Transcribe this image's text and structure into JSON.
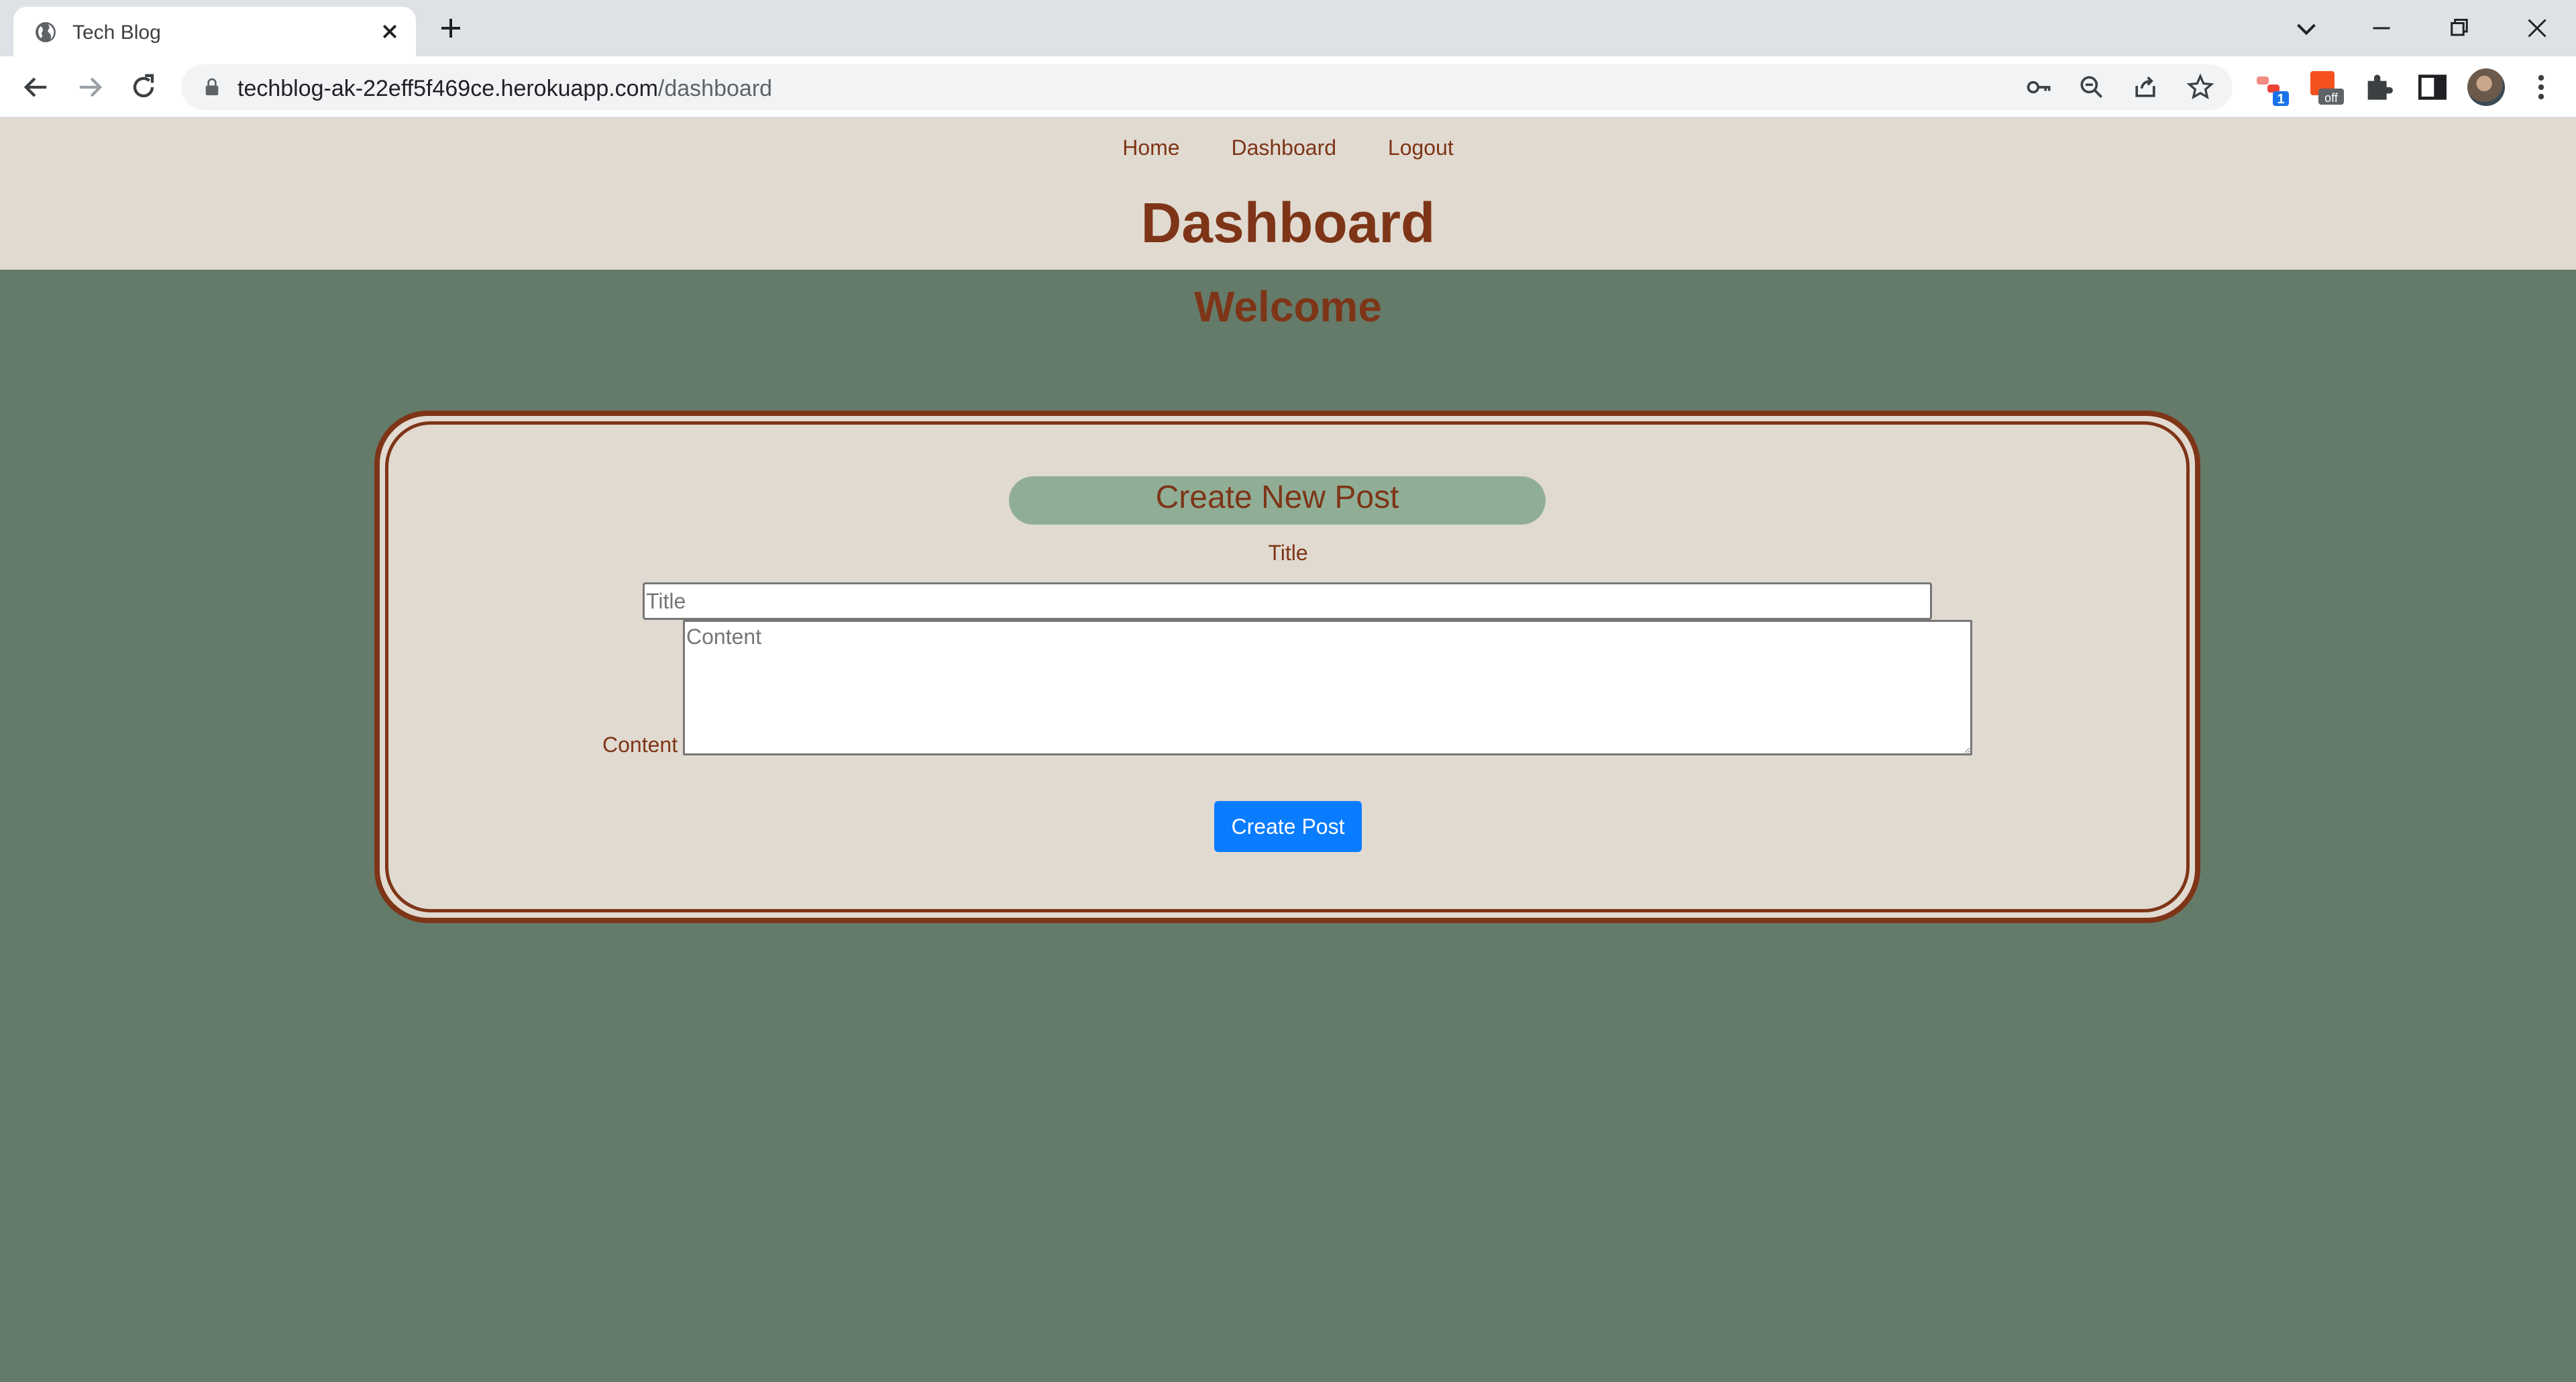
{
  "browser": {
    "tab": {
      "title": "Tech Blog",
      "favicon": "globe-icon"
    },
    "omnibox": {
      "host": "techblog-ak-22eff5f469ce.herokuapp.com",
      "path": "/dashboard"
    },
    "extensions": {
      "badge_count": "1",
      "badge_off": "off"
    },
    "icons": [
      "back-arrow-icon",
      "forward-arrow-icon",
      "reload-icon",
      "lock-icon",
      "key-icon",
      "zoom-out-icon",
      "share-icon",
      "star-icon",
      "puzzle-icon",
      "side-panel-icon",
      "menu-dots-icon"
    ]
  },
  "nav": {
    "home": "Home",
    "dashboard": "Dashboard",
    "logout": "Logout"
  },
  "header": {
    "title": "Dashboard"
  },
  "main": {
    "welcome": "Welcome",
    "form": {
      "heading": "Create New Post",
      "title_label": "Title",
      "title_placeholder": "Title",
      "content_label": "Content",
      "content_placeholder": "Content",
      "submit_label": "Create Post"
    }
  },
  "colors": {
    "page_bg": "#647b6a",
    "header_bg": "#e1dad1",
    "accent_text": "#7e3517",
    "heading_pill": "#90ae96",
    "button": "#0a7cff"
  }
}
